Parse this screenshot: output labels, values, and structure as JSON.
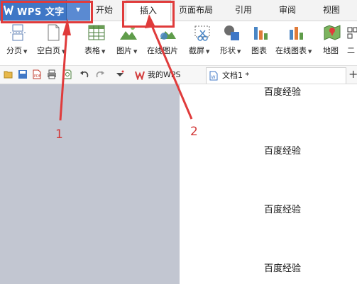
{
  "app": {
    "name": "WPS 文字",
    "brand_color": "#3f77c6"
  },
  "menu_tabs": [
    {
      "label": "开始"
    },
    {
      "label": "插入",
      "active": true
    },
    {
      "label": "页面布局"
    },
    {
      "label": "引用"
    },
    {
      "label": "审阅"
    },
    {
      "label": "视图"
    }
  ],
  "ribbon": {
    "tools": [
      {
        "label": "分页",
        "has_dropdown": true,
        "icon": "page-break-icon"
      },
      {
        "label": "空白页",
        "has_dropdown": true,
        "icon": "blank-page-icon"
      },
      {
        "label": "表格",
        "has_dropdown": true,
        "icon": "table-icon"
      },
      {
        "label": "图片",
        "has_dropdown": true,
        "icon": "picture-icon"
      },
      {
        "label": "在线图片",
        "has_dropdown": false,
        "icon": "online-picture-icon"
      },
      {
        "label": "截屏",
        "has_dropdown": true,
        "icon": "screenshot-icon"
      },
      {
        "label": "形状",
        "has_dropdown": true,
        "icon": "shapes-icon"
      },
      {
        "label": "图表",
        "has_dropdown": false,
        "icon": "chart-icon"
      },
      {
        "label": "在线图表",
        "has_dropdown": true,
        "icon": "online-chart-icon"
      },
      {
        "label": "地图",
        "has_dropdown": false,
        "icon": "map-icon"
      },
      {
        "label": "二",
        "has_dropdown": false,
        "icon": "qrcode-icon"
      }
    ]
  },
  "doc_tabs": [
    {
      "label": "我的WPS",
      "icon": "wps-logo-icon"
    },
    {
      "label": "文档1 *",
      "icon": "document-icon",
      "active": true
    }
  ],
  "document": {
    "lines": [
      "百度经验",
      "百度经验",
      "百度经验",
      "百度经验"
    ]
  },
  "annotations": {
    "callout_1": "1",
    "callout_2": "2",
    "color": "#e03b3b"
  }
}
